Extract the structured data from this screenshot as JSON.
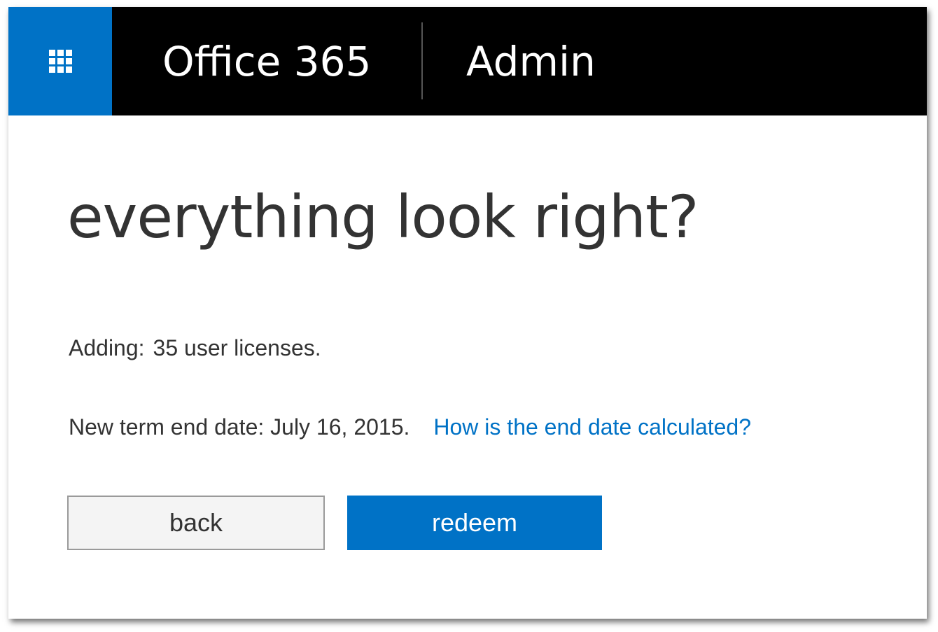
{
  "header": {
    "app_name": "Office 365",
    "section": "Admin",
    "waffle_icon": "app-launcher-waffle-icon",
    "accent_color": "#0072c6",
    "bar_color": "#000000"
  },
  "main": {
    "heading": "everything look right?",
    "adding_label": "Adding:",
    "adding_value": "35 user licenses.",
    "end_date_label": "New term end date:",
    "end_date_value": "July 16, 2015.",
    "end_date_help_link": "How is the end date calculated?",
    "link_color": "#0072c6"
  },
  "actions": {
    "back_label": "back",
    "redeem_label": "redeem"
  }
}
